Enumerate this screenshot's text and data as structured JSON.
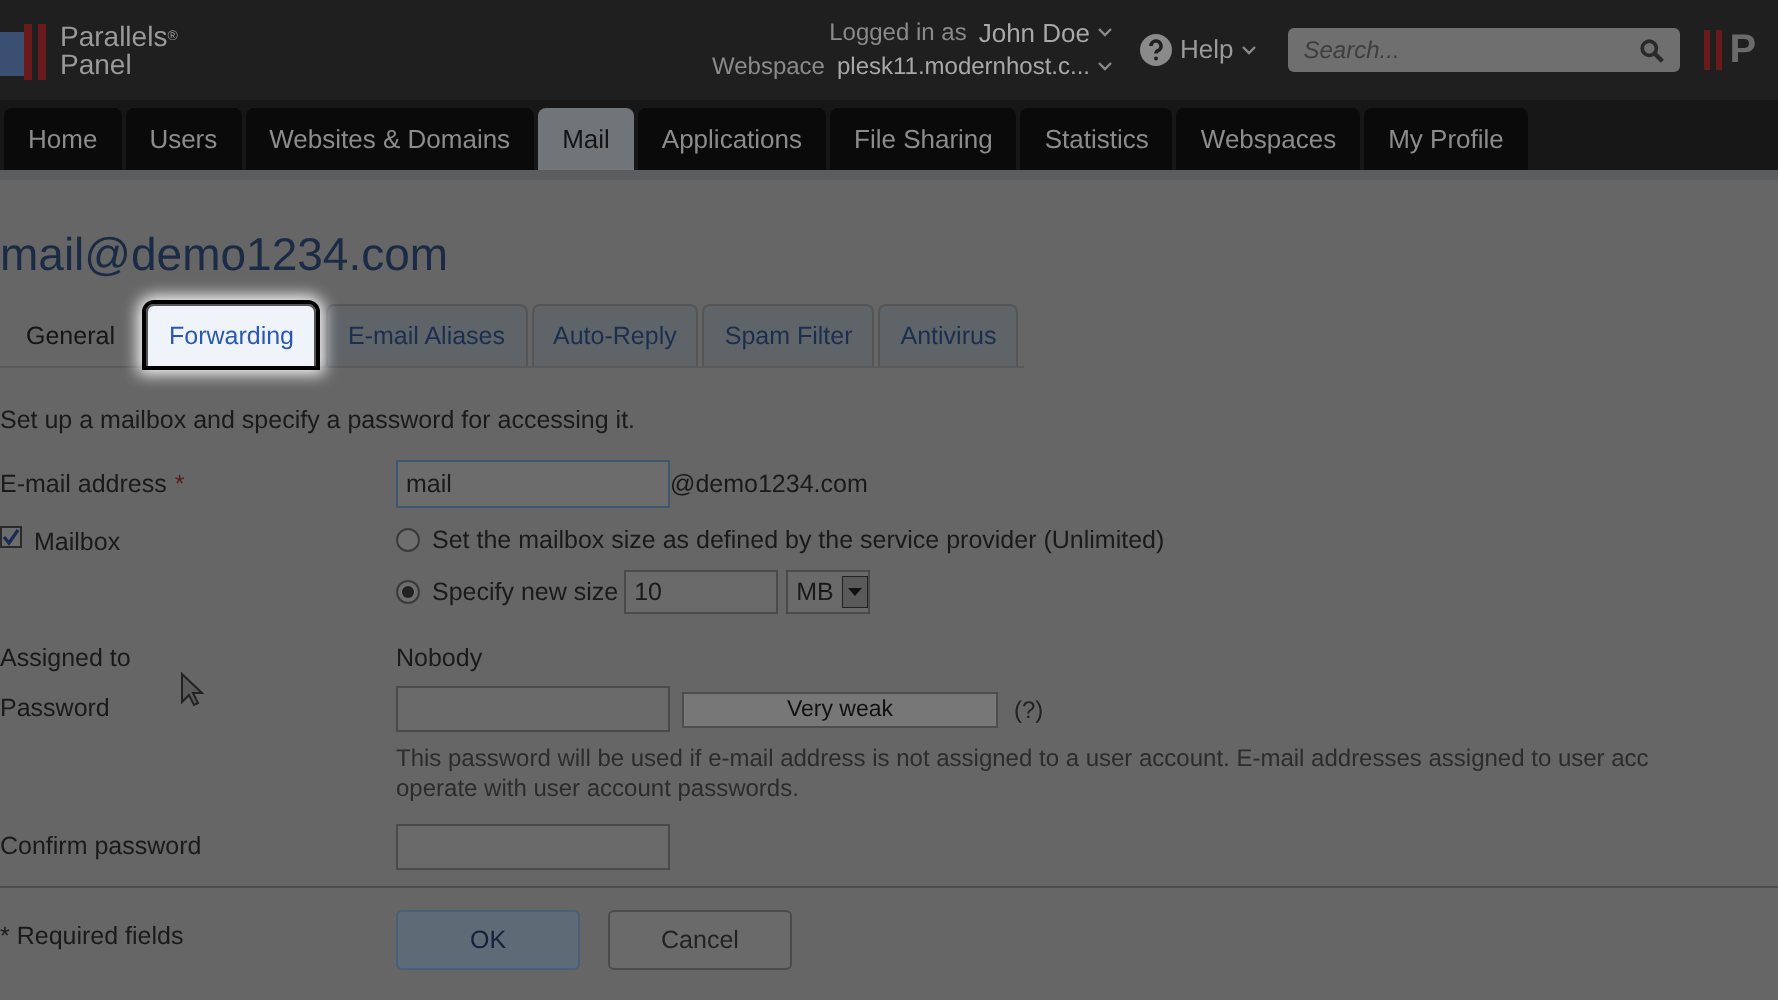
{
  "header": {
    "logo_line1": "Parallels",
    "logo_mark": "®",
    "logo_line2": "Panel",
    "logged_in_label": "Logged in as",
    "user": "John Doe",
    "webspace_label": "Webspace",
    "webspace": "plesk11.modernhost.c...",
    "help": "Help",
    "search": {
      "placeholder": "Search..."
    },
    "logo_fragment": "P"
  },
  "nav_tabs": [
    {
      "label": "Home",
      "selected": false
    },
    {
      "label": "Users",
      "selected": false
    },
    {
      "label": "Websites & Domains",
      "selected": false
    },
    {
      "label": "Mail",
      "selected": true
    },
    {
      "label": "Applications",
      "selected": false
    },
    {
      "label": "File Sharing",
      "selected": false
    },
    {
      "label": "Statistics",
      "selected": false
    },
    {
      "label": "Webspaces",
      "selected": false
    },
    {
      "label": "My Profile",
      "selected": false
    }
  ],
  "title": "mail@demo1234.com",
  "tabs": [
    {
      "label": "General",
      "selected": true,
      "highlighted": false
    },
    {
      "label": "Forwarding",
      "selected": false,
      "highlighted": true
    },
    {
      "label": "E-mail Aliases",
      "selected": false,
      "highlighted": false
    },
    {
      "label": "Auto-Reply",
      "selected": false,
      "highlighted": false
    },
    {
      "label": "Spam Filter",
      "selected": false,
      "highlighted": false
    },
    {
      "label": "Antivirus",
      "selected": false,
      "highlighted": false
    }
  ],
  "intro": "Set up a mailbox and specify a password for accessing it.",
  "form": {
    "email_label": "E-mail address",
    "required_mark": "*",
    "email_value": "mail",
    "email_domain": "@demo1234.com",
    "mailbox": {
      "label": "Mailbox",
      "checked": true
    },
    "size_options": [
      {
        "label": "Set the mailbox size as defined by the service provider (Unlimited)",
        "selected": false
      },
      {
        "label": "Specify new size",
        "selected": true
      }
    ],
    "size_value": "10",
    "size_unit": "MB",
    "assigned_label": "Assigned to",
    "assigned_value": "Nobody",
    "password_label": "Password",
    "strength": "Very weak",
    "help_mark": "(?)",
    "help_lines": [
      "This password will be used if e-mail address is not assigned to a user account. E-mail addresses assigned to user acc",
      "operate with user account passwords."
    ],
    "confirm_label": "Confirm password",
    "required_note": "* Required fields"
  },
  "buttons": [
    {
      "label": "OK",
      "kind": "primary"
    },
    {
      "label": "Cancel",
      "kind": "secondary"
    }
  ]
}
